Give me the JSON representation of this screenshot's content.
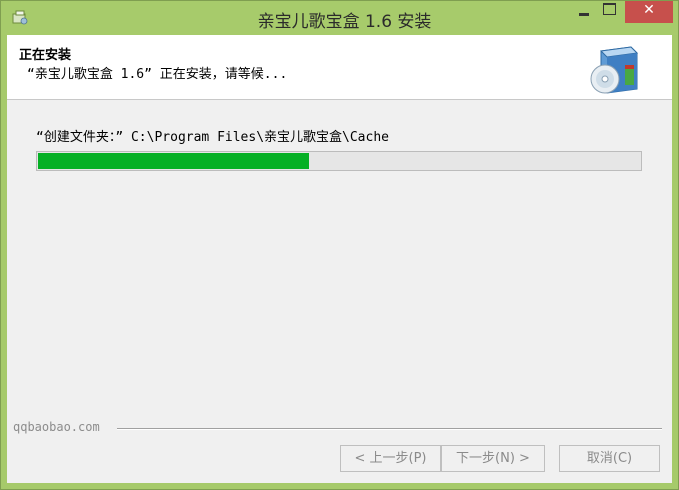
{
  "window": {
    "title": "亲宝儿歌宝盒 1.6 安装",
    "close_glyph": "✕"
  },
  "header": {
    "title": "正在安装",
    "subtitle": "“亲宝儿歌宝盒 1.6” 正在安装，请等候..."
  },
  "status": {
    "text": "“创建文件夹：” C:\\Program Files\\亲宝儿歌宝盒\\Cache",
    "progress": 0.45,
    "progress_color": "#06b025"
  },
  "footer": {
    "brand": "qqbaobao.com",
    "back_label": "< 上一步(P)",
    "next_label": "下一步(N) >",
    "cancel_label": "取消(C)"
  },
  "colors": {
    "title_bar": "#a7cb6b",
    "close_button": "#c7504c"
  }
}
